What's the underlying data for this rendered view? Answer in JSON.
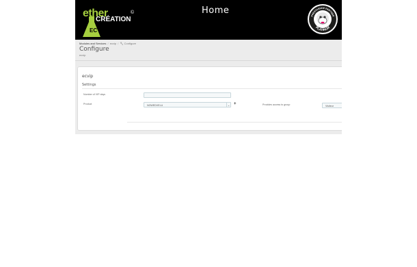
{
  "header": {
    "logo": {
      "ether": "ether",
      "creation": "CRÉATION",
      "copyright": "©",
      "ec": "EC"
    },
    "title": "Home",
    "badge": {
      "top_text": "PRESTASHOP PARTNER",
      "bottom_text": "PLATINUM"
    }
  },
  "breadcrumb": {
    "items": [
      "Modules and Services",
      "ecvip",
      "Configure"
    ],
    "separator": "/"
  },
  "page": {
    "title": "Configure",
    "subtitle": "ecvip"
  },
  "panel": {
    "title": "ecvip",
    "heading": "Settings",
    "fields": {
      "vip_days_label": "Number of VIP days",
      "vip_days_value": "",
      "product_label": "Product",
      "product_value": "NOWEDVELU",
      "group_label": "Provides access to group",
      "group_value": "Visiteur",
      "add_symbol": "+"
    }
  },
  "colors": {
    "topbar": "#000000",
    "logo_green": "#a6cf3f",
    "page_bg": "#ececec",
    "field_bg": "#f5f8f9",
    "field_border": "#c7d6db"
  }
}
